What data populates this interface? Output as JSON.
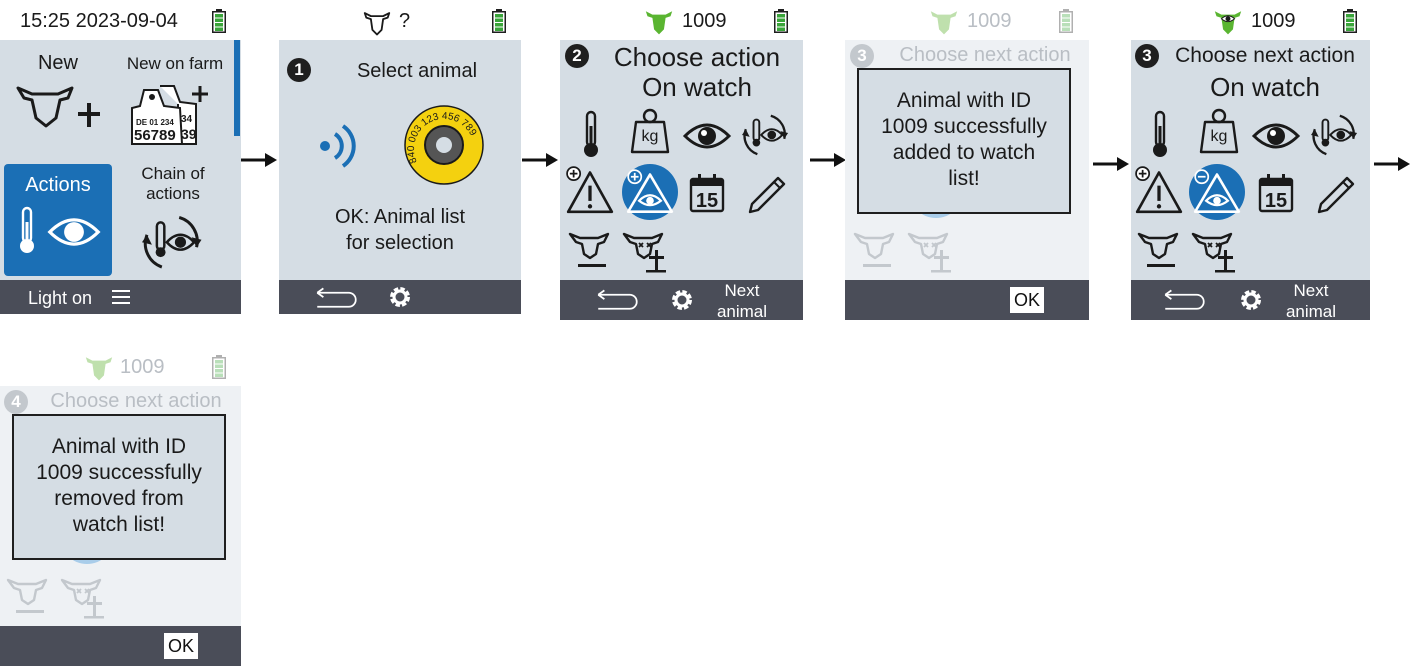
{
  "colors": {
    "accent": "#1b6fb5",
    "screen": "#d5dde4",
    "bar": "#4a4d58",
    "battery": "#3aa53a",
    "cow": "#5ab531"
  },
  "p1": {
    "time": "15:25 2023-09-04",
    "new": "New",
    "new_on_farm": "New on farm",
    "tag_line1": "DE 01 234",
    "tag_line2": "56789",
    "tag_partial": "34",
    "tag_partial2": "39",
    "actions": "Actions",
    "chain": "Chain of actions",
    "light": "Light on"
  },
  "p2": {
    "status": "?",
    "step": "1",
    "title": "Select animal",
    "tag_text": "840 003 123 456 789",
    "ok_line1": "OK: Animal list",
    "ok_line2": "for selection"
  },
  "p3": {
    "status": "1009",
    "step": "2",
    "title1": "Choose action",
    "title2": "On watch",
    "next1": "Next",
    "next2": "animal",
    "kg": "kg",
    "cal": "15"
  },
  "p4": {
    "status": "1009",
    "step": "3",
    "title": "Choose next action",
    "popup": [
      "Animal with ID",
      "1009 successfully",
      "added to watch",
      "list!"
    ],
    "ok": "OK"
  },
  "p5": {
    "status": "1009",
    "step": "3",
    "title1": "Choose next action",
    "title2": "On watch",
    "next1": "Next",
    "next2": "animal",
    "kg": "kg",
    "cal": "15"
  },
  "p6": {
    "status": "1009",
    "step": "4",
    "title": "Choose next action",
    "popup": [
      "Animal with ID",
      "1009 successfully",
      "removed from",
      "watch list!"
    ],
    "ok": "OK"
  }
}
